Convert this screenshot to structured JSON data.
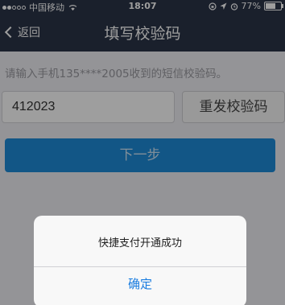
{
  "status_bar": {
    "carrier": "中国移动",
    "time": "18:07",
    "battery_percent": "77%",
    "battery_level": 0.77,
    "signal_bars_filled": 2,
    "signal_bars_total": 5
  },
  "nav": {
    "back_label": "返回",
    "title": "填写校验码"
  },
  "form": {
    "hint": "请输入手机135****2005收到的短信校验码。",
    "code_value": "412023",
    "resend_label": "重发校验码",
    "next_label": "下一步"
  },
  "alert": {
    "message": "快捷支付开通成功",
    "confirm_label": "确定"
  },
  "colors": {
    "nav_bg": "#2b3447",
    "primary": "#1e8bd9",
    "alert_button_text": "#1a7de0"
  },
  "icons": [
    "signal-icon",
    "wifi-icon",
    "lock-rotation-icon",
    "location-icon",
    "alarm-icon",
    "battery-icon",
    "back-chevron-icon"
  ]
}
